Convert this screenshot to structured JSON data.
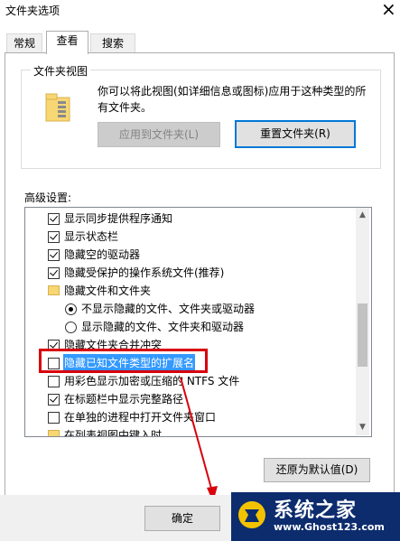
{
  "window": {
    "title": "文件夹选项"
  },
  "tabs": [
    {
      "label": "常规"
    },
    {
      "label": "查看"
    },
    {
      "label": "搜索"
    }
  ],
  "folder_views": {
    "legend": "文件夹视图",
    "description": "你可以将此视图(如详细信息或图标)应用于这种类型的所有文件夹。",
    "apply_button": "应用到文件夹(L)",
    "reset_button": "重置文件夹(R)"
  },
  "advanced": {
    "label": "高级设置:",
    "items": [
      {
        "kind": "checkbox",
        "checked": true,
        "text": "显示同步提供程序通知"
      },
      {
        "kind": "checkbox",
        "checked": true,
        "text": "显示状态栏"
      },
      {
        "kind": "checkbox",
        "checked": true,
        "text": "隐藏空的驱动器"
      },
      {
        "kind": "checkbox",
        "checked": true,
        "text": "隐藏受保护的操作系统文件(推荐)"
      },
      {
        "kind": "folder",
        "text": "隐藏文件和文件夹"
      },
      {
        "kind": "radio",
        "checked": true,
        "text": "不显示隐藏的文件、文件夹或驱动器"
      },
      {
        "kind": "radio",
        "checked": false,
        "text": "显示隐藏的文件、文件夹和驱动器"
      },
      {
        "kind": "checkbox",
        "checked": true,
        "text": "隐藏文件夹合并冲突"
      },
      {
        "kind": "checkbox",
        "checked": false,
        "text": "隐藏已知文件类型的扩展名"
      },
      {
        "kind": "checkbox",
        "checked": false,
        "text": "用彩色显示加密或压缩的 NTFS 文件"
      },
      {
        "kind": "checkbox",
        "checked": true,
        "text": "在标题栏中显示完整路径"
      },
      {
        "kind": "checkbox",
        "checked": false,
        "text": "在单独的进程中打开文件夹窗口"
      },
      {
        "kind": "folder",
        "text": "在列表视图中键入时"
      }
    ],
    "restore_button": "还原为默认值(D)"
  },
  "footer": {
    "ok_button": "确定"
  },
  "watermark": {
    "text": "系统之家",
    "url": "www.Ghost123.com"
  }
}
